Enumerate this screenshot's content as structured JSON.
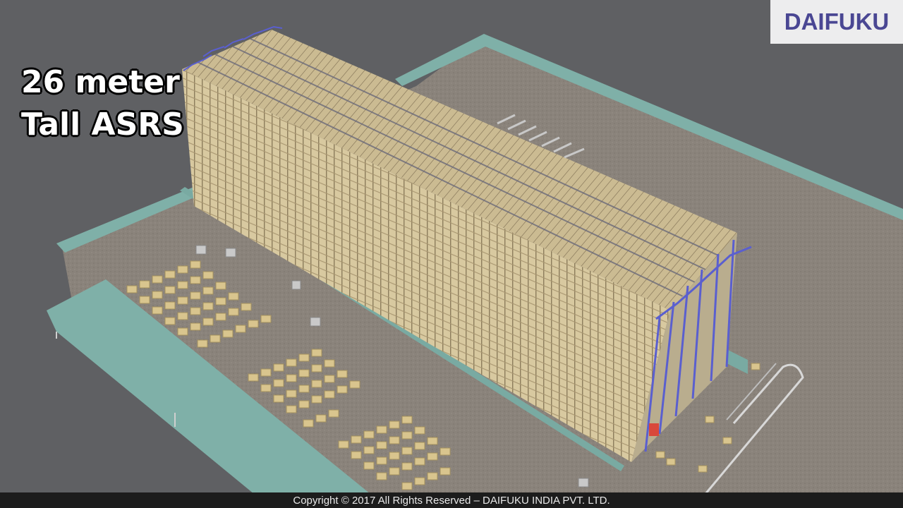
{
  "headline": {
    "line1": "26 meter",
    "line2": "Tall ASRS"
  },
  "logo": {
    "text": "DAIFUKU",
    "color": "#4a4793",
    "background": "#ededee"
  },
  "footer": {
    "copyright": "Copyright © 2017 All Rights Reserved – DAIFUKU INDIA PVT. LTD."
  },
  "colors": {
    "background": "#5f6063",
    "floor": "#8a837b",
    "wall": "#7fb0a8",
    "rack_front": "#d8c9a0",
    "rack_lines": "#8f7f5f",
    "crane_frames": "#5a5fcf",
    "pallet": "#d9c58e"
  }
}
